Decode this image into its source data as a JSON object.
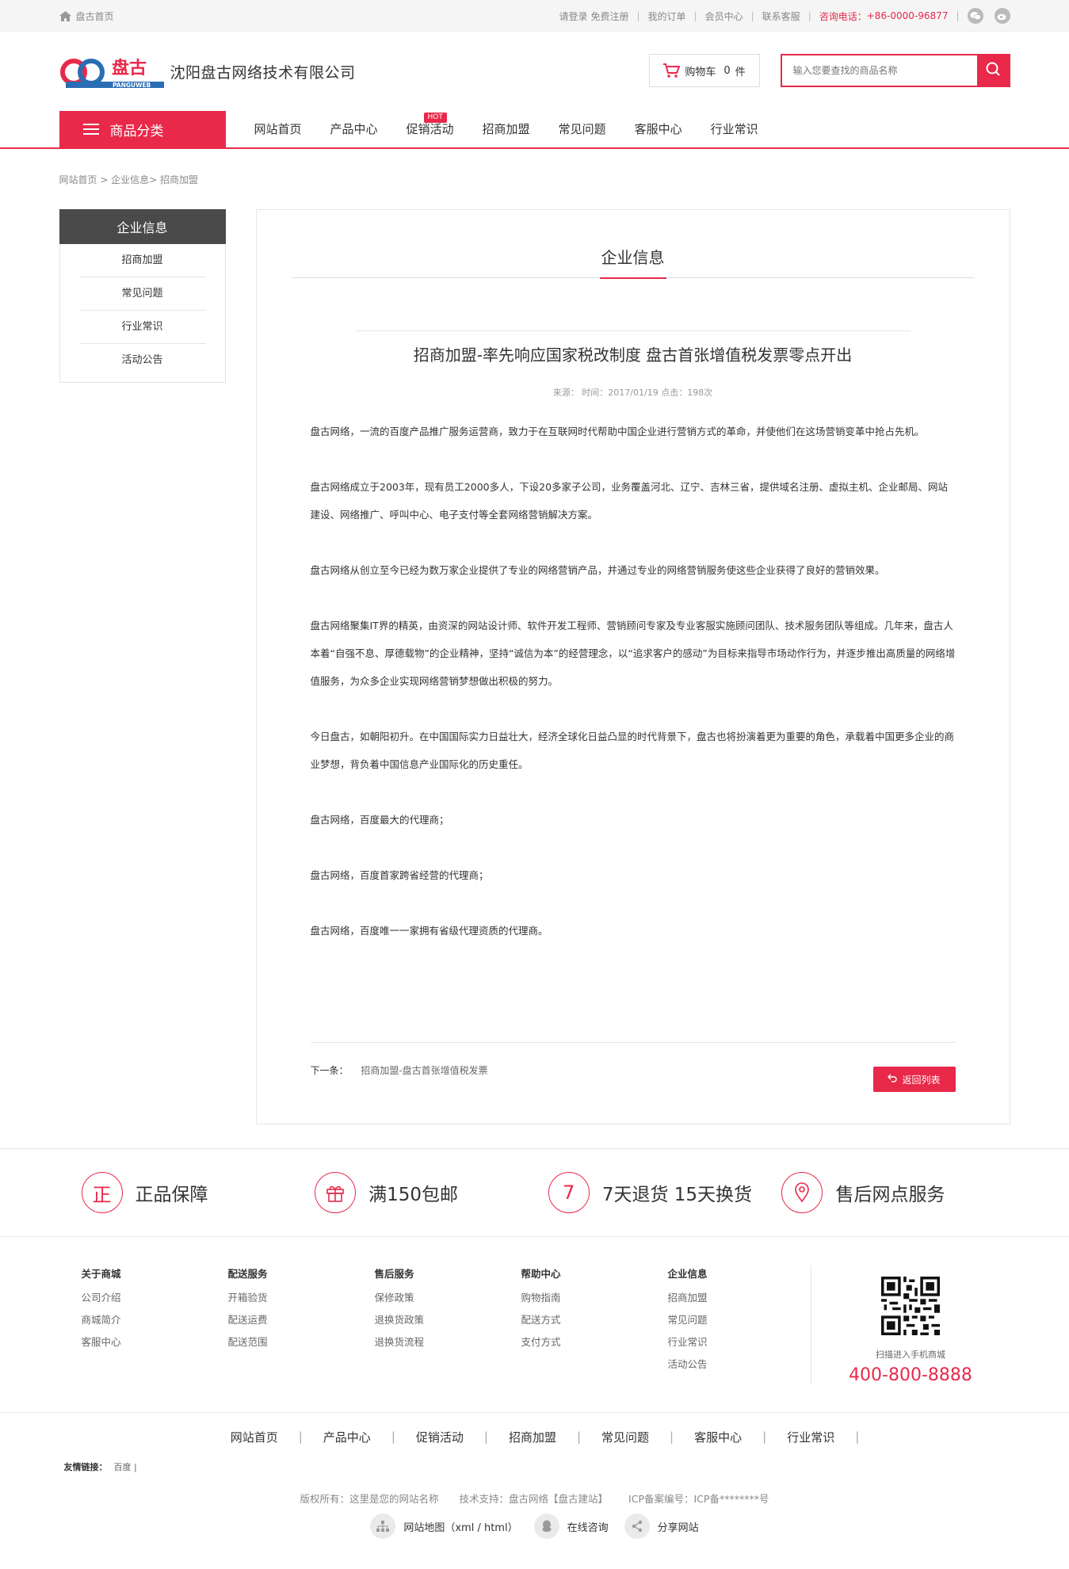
{
  "topbar": {
    "home": "盘古首页",
    "login": "请登录",
    "register": "免费注册",
    "orders": "我的订单",
    "member": "会员中心",
    "contact": "联系客服",
    "hotline_label": "咨询电话：",
    "hotline": "+86-0000-96877",
    "sep": "|"
  },
  "header": {
    "logo_text": "盘古",
    "logo_sub": "PANGUWEB",
    "company": "沈阳盘古网络技术有限公司",
    "cart_label": "购物车",
    "cart_count": "0",
    "cart_unit": "件",
    "search_placeholder": "输入您要查找的商品名称"
  },
  "nav": {
    "category": "商品分类",
    "items": [
      {
        "label": "网站首页"
      },
      {
        "label": "产品中心"
      },
      {
        "label": "促销活动",
        "badge": "HOT"
      },
      {
        "label": "招商加盟"
      },
      {
        "label": "常见问题"
      },
      {
        "label": "客服中心"
      },
      {
        "label": "行业常识"
      }
    ]
  },
  "breadcrumb": "网站首页 > 企业信息> 招商加盟",
  "sidebar": {
    "title": "企业信息",
    "items": [
      {
        "label": "招商加盟"
      },
      {
        "label": "常见问题"
      },
      {
        "label": "行业常识"
      },
      {
        "label": "活动公告"
      }
    ]
  },
  "article": {
    "section": "企业信息",
    "title": "招商加盟-率先响应国家税改制度 盘古首张增值税发票零点开出",
    "meta": "来源：  时间：2017/01/19  点击：198次",
    "paragraphs": [
      "盘古网络，一流的百度产品推广服务运营商，致力于在互联网时代帮助中国企业进行营销方式的革命，并使他们在这场营销变革中抢占先机。",
      "盘古网络成立于2003年，现有员工2000多人，下设20多家子公司，业务覆盖河北、辽宁、吉林三省，提供域名注册、虚拟主机、企业邮局、网站建设、网络推广、呼叫中心、电子支付等全套网络营销解决方案。",
      "盘古网络从创立至今已经为数万家企业提供了专业的网络营销产品，并通过专业的网络营销服务使这些企业获得了良好的营销效果。",
      "盘古网络聚集IT界的精英，由资深的网站设计师、软件开发工程师、营销顾问专家及专业客服实施顾问团队、技术服务团队等组成。几年来，盘古人本着“自强不息、厚德载物”的企业精神，坚持“诚信为本”的经营理念，以“追求客户的感动”为目标来指导市场动作行为，并逐步推出高质量的网络增值服务，为众多企业实现网络营销梦想做出积极的努力。",
      "今日盘古，如朝阳初升。在中国国际实力日益壮大，经济全球化日益凸显的时代背景下，盘古也将扮演着更为重要的角色，承载着中国更多企业的商业梦想，背负着中国信息产业国际化的历史重任。",
      "盘古网络，百度最大的代理商；",
      "盘古网络，百度首家跨省经营的代理商；",
      "盘古网络，百度唯一一家拥有省级代理资质的代理商。"
    ],
    "next_label": "下一条：",
    "next_title": "招商加盟-盘古首张增值税发票",
    "back": "返回列表"
  },
  "services": [
    {
      "icon_char": "正",
      "label": "正品保障"
    },
    {
      "icon_char": "gift",
      "label": "满150包邮"
    },
    {
      "icon_char": "7",
      "label": "7天退货 15天换货"
    },
    {
      "icon_char": "pin",
      "label": "售后网点服务"
    }
  ],
  "footer_cols": [
    {
      "title": "关于商城",
      "links": [
        "公司介绍",
        "商城简介",
        "客服中心"
      ]
    },
    {
      "title": "配送服务",
      "links": [
        "开箱验货",
        "配送运费",
        "配送范围"
      ]
    },
    {
      "title": "售后服务",
      "links": [
        "保修政策",
        "退换货政策",
        "退换货流程"
      ]
    },
    {
      "title": "帮助中心",
      "links": [
        "购物指南",
        "配送方式",
        "支付方式"
      ]
    },
    {
      "title": "企业信息",
      "links": [
        "招商加盟",
        "常见问题",
        "行业常识",
        "活动公告"
      ]
    }
  ],
  "qr": {
    "caption": "扫描进入手机商城",
    "phone": "400-800-8888"
  },
  "bottom_nav": [
    "网站首页",
    "产品中心",
    "促销活动",
    "招商加盟",
    "常见问题",
    "客服中心",
    "行业常识"
  ],
  "friend_links": {
    "label": "友情链接：",
    "items": "百度 |"
  },
  "copyright": {
    "owner": "版权所有：这里是您的网站名称",
    "support": "技术支持：盘古网络【盘古建站】",
    "icp": "ICP备案编号：ICP备********号"
  },
  "tools": [
    {
      "icon": "sitemap-icon",
      "label": "网站地图（xml / html）"
    },
    {
      "icon": "chat-icon",
      "label": "在线咨询"
    },
    {
      "icon": "share-icon",
      "label": "分享网站"
    }
  ],
  "colors": {
    "accent": "#e8294a",
    "dark": "#4a4a4a"
  }
}
